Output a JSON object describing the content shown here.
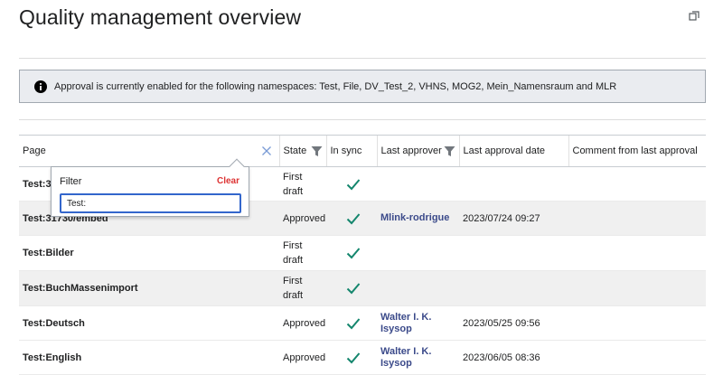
{
  "page": {
    "title": "Quality management overview"
  },
  "notice": {
    "text": "Approval is currently enabled for the following namespaces: Test, File, DV_Test_2, VHNS, MOG2, Mein_Namensraum and MLR"
  },
  "table": {
    "columns": {
      "page": "Page",
      "state": "State",
      "sync": "In sync",
      "approver": "Last approver",
      "date": "Last approval date",
      "comment": "Comment from last approval"
    },
    "rows": [
      {
        "page": "Test:31",
        "state": "First draft",
        "in_sync": true,
        "approver": "",
        "date": "",
        "comment": ""
      },
      {
        "page": "Test:31730/embed",
        "state": "Approved",
        "in_sync": true,
        "approver": "Mlink-rodrigue",
        "date": "2023/07/24 09:27",
        "comment": ""
      },
      {
        "page": "Test:Bilder",
        "state": "First draft",
        "in_sync": true,
        "approver": "",
        "date": "",
        "comment": ""
      },
      {
        "page": "Test:BuchMassenimport",
        "state": "First draft",
        "in_sync": true,
        "approver": "",
        "date": "",
        "comment": ""
      },
      {
        "page": "Test:Deutsch",
        "state": "Approved",
        "in_sync": true,
        "approver": "Walter I. K. Isysop",
        "date": "2023/05/25 09:56",
        "comment": ""
      },
      {
        "page": "Test:English",
        "state": "Approved",
        "in_sync": true,
        "approver": "Walter I. K. Isysop",
        "date": "2023/06/05 08:36",
        "comment": ""
      }
    ]
  },
  "filter_popup": {
    "label": "Filter",
    "clear_label": "Clear",
    "value": "Test:"
  },
  "icons": {
    "expand": "expand-icon",
    "info": "info-icon",
    "filter": "filter-icon",
    "clear": "close-icon",
    "check": "check-icon"
  },
  "colors": {
    "check": "#14866d",
    "link": "#3b4a8a",
    "clear": "#d33333",
    "input_border": "#3366cc"
  }
}
